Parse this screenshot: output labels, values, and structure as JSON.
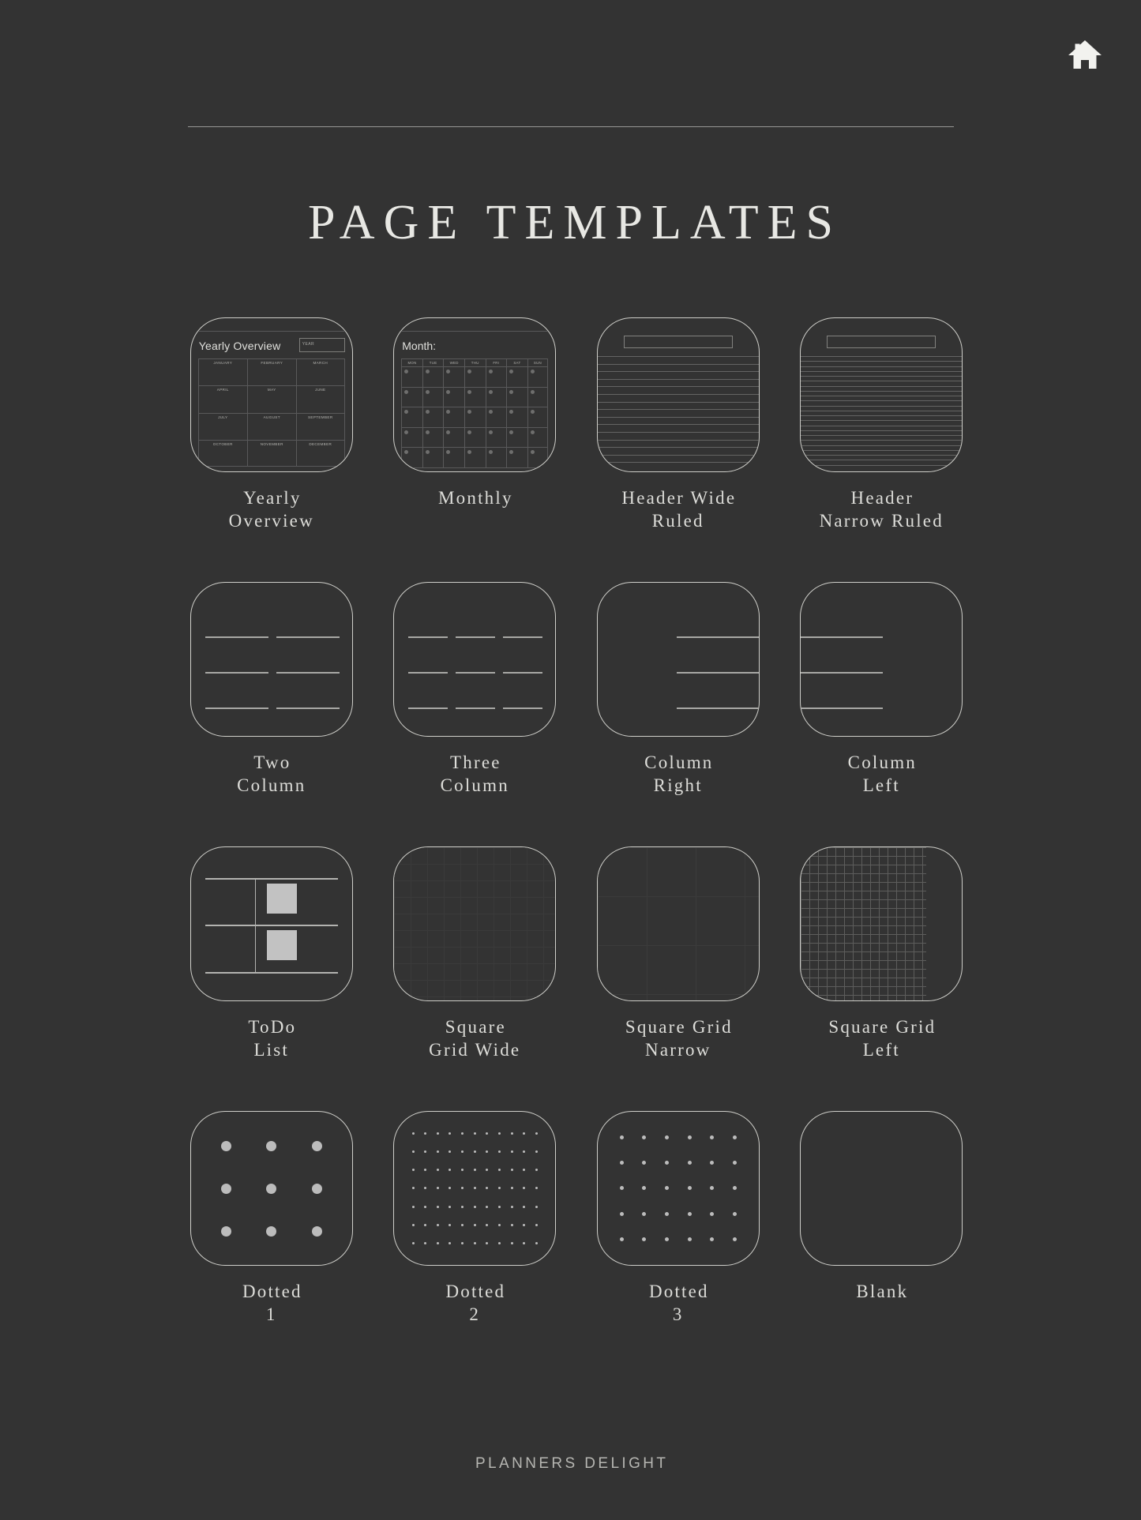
{
  "header": {
    "home_icon": "home-icon"
  },
  "page_title": "PAGE TEMPLATES",
  "footer": {
    "brand": "PLANNERS DELIGHT"
  },
  "colors": {
    "background": "#333333",
    "card_border": "#cfcfca",
    "text_primary": "#e8e8e4",
    "text_muted": "#b6b6b2",
    "rule": "#8f8f8c",
    "fill_square": "#c2c2c2"
  },
  "templates": [
    {
      "id": "yearly-overview",
      "label": "Yearly\nOverview",
      "preview": "yearly",
      "preview_text": {
        "title": "Yearly Overview",
        "year_field": "YEAR",
        "months": [
          "JANUARY",
          "FEBRUARY",
          "MARCH",
          "APRIL",
          "MAY",
          "JUNE",
          "JULY",
          "AUGUST",
          "SEPTEMBER",
          "OCTOBER",
          "NOVEMBER",
          "DECEMBER"
        ]
      }
    },
    {
      "id": "monthly",
      "label": "Monthly",
      "preview": "monthly",
      "preview_text": {
        "title": "Month:",
        "weekdays": [
          "MON",
          "TUE",
          "WED",
          "THU",
          "FRI",
          "SAT",
          "SUN"
        ],
        "weeks": 5
      }
    },
    {
      "id": "header-wide-ruled",
      "label": "Header Wide\nRuled",
      "preview": "ruled",
      "preview_spec": {
        "lines": 15,
        "header_box": true
      }
    },
    {
      "id": "header-narrow-ruled",
      "label": "Header\nNarrow Ruled",
      "preview": "ruled",
      "preview_spec": {
        "lines": 23,
        "header_box": true
      }
    },
    {
      "id": "two-column",
      "label": "Two\nColumn",
      "preview": "columns",
      "preview_spec": {
        "columns": 2,
        "rows": 3
      }
    },
    {
      "id": "three-column",
      "label": "Three\nColumn",
      "preview": "columns",
      "preview_spec": {
        "columns": 3,
        "rows": 3
      }
    },
    {
      "id": "column-right",
      "label": "Column\nRight",
      "preview": "side-column",
      "preview_spec": {
        "side": "right",
        "rows": 3
      }
    },
    {
      "id": "column-left",
      "label": "Column\nLeft",
      "preview": "side-column",
      "preview_spec": {
        "side": "left",
        "rows": 3
      }
    },
    {
      "id": "todo-list",
      "label": "ToDo\nList",
      "preview": "todo",
      "preview_spec": {
        "rows": 3,
        "checkboxes": 2
      }
    },
    {
      "id": "square-grid-wide",
      "label": "Square\nGrid Wide",
      "preview": "squaregrid",
      "preview_spec": {
        "cell": 21,
        "inset": 0,
        "color": "#3a3a3a"
      }
    },
    {
      "id": "square-grid-narrow",
      "label": "Square Grid\nNarrow",
      "preview": "squaregrid",
      "preview_spec": {
        "cell": 62,
        "inset": 0,
        "color": "#3b3b3b"
      }
    },
    {
      "id": "square-grid-left",
      "label": "Square Grid\nLeft",
      "preview": "squaregrid-left",
      "preview_spec": {
        "cell": 11,
        "width_pct": 78,
        "color": "#5d5d5c"
      }
    },
    {
      "id": "dotted-1",
      "label": "Dotted\n1",
      "preview": "dots",
      "preview_spec": {
        "cols": 3,
        "rows": 3,
        "size": 13
      }
    },
    {
      "id": "dotted-2",
      "label": "Dotted\n2",
      "preview": "dots",
      "preview_spec": {
        "cols": 11,
        "rows": 7,
        "size": 3
      }
    },
    {
      "id": "dotted-3",
      "label": "Dotted\n3",
      "preview": "dots",
      "preview_spec": {
        "cols": 6,
        "rows": 5,
        "size": 5
      }
    },
    {
      "id": "blank",
      "label": "Blank",
      "preview": "blank",
      "preview_spec": {}
    }
  ]
}
